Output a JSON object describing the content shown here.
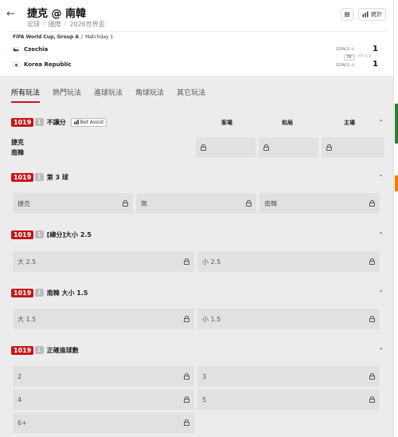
{
  "header": {
    "back_label": "←",
    "title": "捷克 @ 南韓",
    "breadcrumb": [
      "足球",
      "國際",
      "2026世界盃"
    ],
    "stats_label": "統計"
  },
  "match": {
    "competition": "FIFA World Cup, Group A",
    "matchday": "Matchday 1",
    "home": {
      "name": "Czechia",
      "score": "1",
      "flag": "czech-flag"
    },
    "away": {
      "name": "Korea Republic",
      "score": "1",
      "flag": "korea-flag"
    },
    "goals_label": "GOALS",
    "minute": "78'",
    "half_time": "HT 0-0"
  },
  "tabs": [
    {
      "label": "所有玩法",
      "active": true
    },
    {
      "label": "熱門玩法",
      "active": false
    },
    {
      "label": "進球玩法",
      "active": false
    },
    {
      "label": "角球玩法",
      "active": false
    },
    {
      "label": "其它玩法",
      "active": false
    }
  ],
  "markets": {
    "m1": {
      "code": "1019",
      "count": "1",
      "title": "不讓分",
      "assist": "Bet Assist",
      "cols": [
        "客場",
        "和局",
        "主場"
      ],
      "teams": [
        "捷克",
        "南韓"
      ]
    },
    "m2": {
      "code": "1019",
      "count": "1",
      "title": "第 3 球",
      "options": [
        "捷克",
        "無",
        "南韓"
      ]
    },
    "m3": {
      "code": "1019",
      "count": "1",
      "title": "[總分]大小 2.5",
      "options": [
        "大 2.5",
        "小 2.5"
      ]
    },
    "m4": {
      "code": "1019",
      "count": "1",
      "title": "南韓 大小 1.5",
      "options": [
        "大 1.5",
        "小 1.5"
      ]
    },
    "m5": {
      "code": "1019",
      "count": "1",
      "title": "正確進球數",
      "options": [
        "2",
        "3",
        "4",
        "5",
        "6+"
      ]
    }
  },
  "colors": {
    "accent": "#c4161c",
    "odds_bg": "#e1e1e1"
  }
}
